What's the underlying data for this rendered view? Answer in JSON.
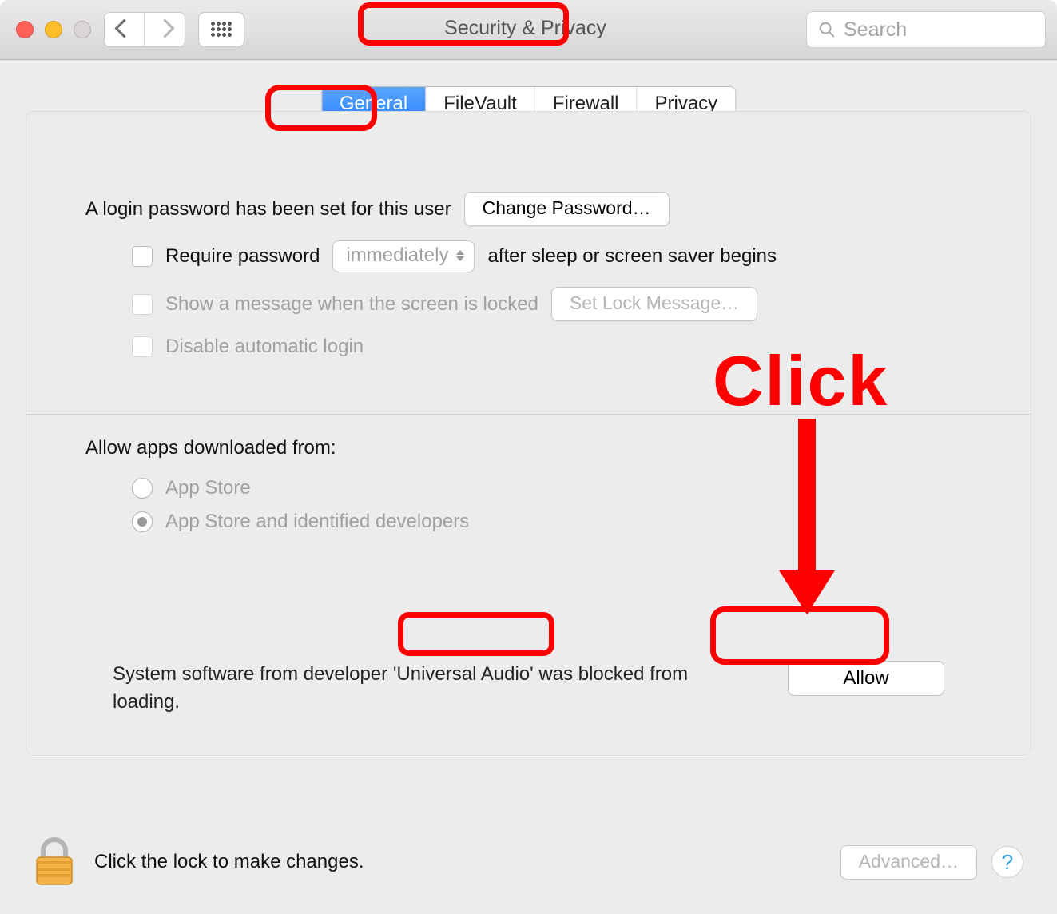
{
  "window": {
    "title": "Security & Privacy",
    "search_placeholder": "Search"
  },
  "tabs": [
    "General",
    "FileVault",
    "Firewall",
    "Privacy"
  ],
  "active_tab": "General",
  "login": {
    "password_set_text": "A login password has been set for this user",
    "change_password_label": "Change Password…",
    "require_password_label": "Require password",
    "require_password_delay": "immediately",
    "require_password_suffix": "after sleep or screen saver begins",
    "show_message_label": "Show a message when the screen is locked",
    "set_lock_message_label": "Set Lock Message…",
    "disable_auto_login_label": "Disable automatic login"
  },
  "downloads": {
    "heading": "Allow apps downloaded from:",
    "option_appstore": "App Store",
    "option_identified": "App Store and identified developers",
    "selected": "identified"
  },
  "blocked": {
    "prefix": "System software from developer ",
    "developer": "'Universal Audio'",
    "suffix": " was blocked from loading.",
    "allow_label": "Allow"
  },
  "footer": {
    "lock_hint": "Click the lock to make changes.",
    "advanced_label": "Advanced…"
  },
  "annotation": {
    "click_label": "Click"
  }
}
